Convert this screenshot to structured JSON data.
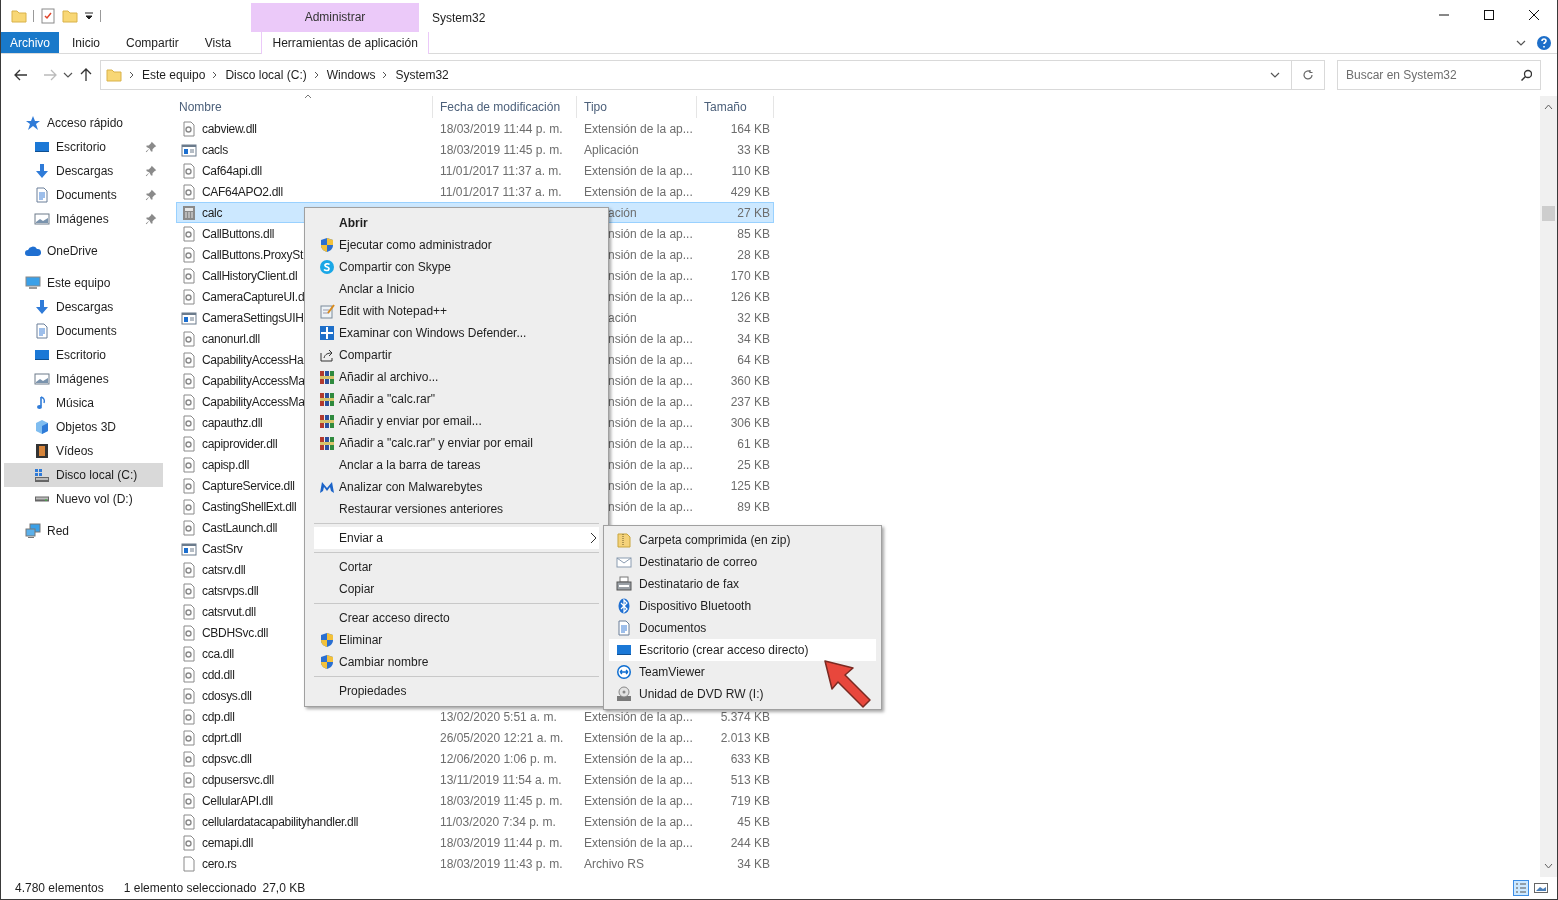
{
  "window": {
    "title": "System32",
    "contextual_group": "Administrar"
  },
  "ribbon": {
    "tabs": [
      {
        "label": "Archivo",
        "kind": "file"
      },
      {
        "label": "Inicio",
        "kind": "normal"
      },
      {
        "label": "Compartir",
        "kind": "normal"
      },
      {
        "label": "Vista",
        "kind": "normal"
      },
      {
        "label": "Herramientas de aplicación",
        "kind": "contextual"
      }
    ]
  },
  "address": {
    "crumbs": [
      "Este equipo",
      "Disco local (C:)",
      "Windows",
      "System32"
    ]
  },
  "search": {
    "placeholder": "Buscar en System32"
  },
  "sidebar": {
    "groups": [
      {
        "label": "Acceso rápido",
        "selected": false,
        "children": [
          {
            "label": "Escritorio",
            "pinned": true,
            "selected": false
          },
          {
            "label": "Descargas",
            "pinned": true,
            "selected": false
          },
          {
            "label": "Documents",
            "pinned": true,
            "selected": false
          },
          {
            "label": "Imágenes",
            "pinned": true,
            "selected": false
          }
        ]
      },
      {
        "label": "OneDrive",
        "selected": false
      },
      {
        "label": "Este equipo",
        "selected": false,
        "children": [
          {
            "label": "Descargas",
            "pinned": false,
            "selected": false
          },
          {
            "label": "Documents",
            "pinned": false,
            "selected": false
          },
          {
            "label": "Escritorio",
            "pinned": false,
            "selected": false
          },
          {
            "label": "Imágenes",
            "pinned": false,
            "selected": false
          },
          {
            "label": "Música",
            "pinned": false,
            "selected": false
          },
          {
            "label": "Objetos 3D",
            "pinned": false,
            "selected": false
          },
          {
            "label": "Vídeos",
            "pinned": false,
            "selected": false
          },
          {
            "label": "Disco local (C:)",
            "pinned": false,
            "selected": true
          },
          {
            "label": "Nuevo vol (D:)",
            "pinned": false,
            "selected": false
          }
        ]
      },
      {
        "label": "Red",
        "selected": false
      }
    ]
  },
  "file_list": {
    "columns": [
      {
        "label": "Nombre",
        "sorted": true
      },
      {
        "label": "Fecha de modificación",
        "sorted": false
      },
      {
        "label": "Tipo",
        "sorted": false
      },
      {
        "label": "Tamaño",
        "sorted": false
      }
    ],
    "rows": [
      {
        "name": "cabview.dll",
        "kind": "dll",
        "date": "18/03/2019 11:44 p. m.",
        "type": "Extensión de la ap...",
        "size": "164 KB",
        "selected": false
      },
      {
        "name": "cacls",
        "kind": "app",
        "date": "18/03/2019 11:45 p. m.",
        "type": "Aplicación",
        "size": "33 KB",
        "selected": false
      },
      {
        "name": "Caf64api.dll",
        "kind": "dll",
        "date": "11/01/2017 11:37 a. m.",
        "type": "Extensión de la ap...",
        "size": "110 KB",
        "selected": false
      },
      {
        "name": "CAF64APO2.dll",
        "kind": "dll",
        "date": "11/01/2017 11:37 a. m.",
        "type": "Extensión de la ap...",
        "size": "429 KB",
        "selected": false
      },
      {
        "name": "calc",
        "kind": "calc",
        "type": "ación",
        "size": "27 KB",
        "selected": true
      },
      {
        "name": "CallButtons.dll",
        "kind": "dll",
        "type": "nsión de la ap...",
        "size": "85 KB",
        "selected": false
      },
      {
        "name": "CallButtons.ProxySt",
        "kind": "dll",
        "type": "nsión de la ap...",
        "size": "28 KB",
        "selected": false
      },
      {
        "name": "CallHistoryClient.dl",
        "kind": "dll",
        "type": "nsión de la ap...",
        "size": "170 KB",
        "selected": false
      },
      {
        "name": "CameraCaptureUI.d",
        "kind": "dll",
        "type": "nsión de la ap...",
        "size": "126 KB",
        "selected": false
      },
      {
        "name": "CameraSettingsUIH",
        "kind": "app",
        "type": "ación",
        "size": "32 KB",
        "selected": false
      },
      {
        "name": "canonurl.dll",
        "kind": "dll",
        "type": "nsión de la ap...",
        "size": "34 KB",
        "selected": false
      },
      {
        "name": "CapabilityAccessHa",
        "kind": "dll",
        "type": "nsión de la ap...",
        "size": "64 KB",
        "selected": false
      },
      {
        "name": "CapabilityAccessMa",
        "kind": "dll",
        "type": "nsión de la ap...",
        "size": "360 KB",
        "selected": false
      },
      {
        "name": "CapabilityAccessMa",
        "kind": "dll",
        "type": "nsión de la ap...",
        "size": "237 KB",
        "selected": false
      },
      {
        "name": "capauthz.dll",
        "kind": "dll",
        "type": "nsión de la ap...",
        "size": "306 KB",
        "selected": false
      },
      {
        "name": "capiprovider.dll",
        "kind": "dll",
        "type": "nsión de la ap...",
        "size": "61 KB",
        "selected": false
      },
      {
        "name": "capisp.dll",
        "kind": "dll",
        "type": "nsión de la ap...",
        "size": "25 KB",
        "selected": false
      },
      {
        "name": "CaptureService.dll",
        "kind": "dll",
        "type": "nsión de la ap...",
        "size": "125 KB",
        "selected": false
      },
      {
        "name": "CastingShellExt.dll",
        "kind": "dll",
        "type": "nsión de la ap...",
        "size": "89 KB",
        "selected": false
      },
      {
        "name": "CastLaunch.dll",
        "kind": "dll",
        "selected": false
      },
      {
        "name": "CastSrv",
        "kind": "app",
        "selected": false
      },
      {
        "name": "catsrv.dll",
        "kind": "dll",
        "selected": false
      },
      {
        "name": "catsrvps.dll",
        "kind": "dll",
        "selected": false
      },
      {
        "name": "catsrvut.dll",
        "kind": "dll",
        "selected": false
      },
      {
        "name": "CBDHSvc.dll",
        "kind": "dll",
        "selected": false
      },
      {
        "name": "cca.dll",
        "kind": "dll",
        "selected": false
      },
      {
        "name": "cdd.dll",
        "kind": "dll",
        "selected": false
      },
      {
        "name": "cdosys.dll",
        "kind": "dll",
        "selected": false
      },
      {
        "name": "cdp.dll",
        "kind": "dll",
        "date": "13/02/2020 5:51 a. m.",
        "type": "Extensión de la ap...",
        "size": "5.374 KB",
        "selected": false
      },
      {
        "name": "cdprt.dll",
        "kind": "dll",
        "date": "26/05/2020 12:21 a. m.",
        "type": "Extensión de la ap...",
        "size": "2.013 KB",
        "selected": false
      },
      {
        "name": "cdpsvc.dll",
        "kind": "dll",
        "date": "12/06/2020 1:06 p. m.",
        "type": "Extensión de la ap...",
        "size": "633 KB",
        "selected": false
      },
      {
        "name": "cdpusersvc.dll",
        "kind": "dll",
        "date": "13/11/2019 11:54 a. m.",
        "type": "Extensión de la ap...",
        "size": "513 KB",
        "selected": false
      },
      {
        "name": "CellularAPI.dll",
        "kind": "dll",
        "date": "18/03/2019 11:45 p. m.",
        "type": "Extensión de la ap...",
        "size": "719 KB",
        "selected": false
      },
      {
        "name": "cellulardatacapabilityhandler.dll",
        "kind": "dll",
        "date": "11/03/2020 7:34 p. m.",
        "type": "Extensión de la ap...",
        "size": "45 KB",
        "selected": false
      },
      {
        "name": "cemapi.dll",
        "kind": "dll",
        "date": "18/03/2019 11:44 p. m.",
        "type": "Extensión de la ap...",
        "size": "244 KB",
        "selected": false
      },
      {
        "name": "cero.rs",
        "kind": "file",
        "date": "18/03/2019 11:43 p. m.",
        "type": "Archivo RS",
        "size": "34 KB",
        "selected": false
      }
    ]
  },
  "context_menu": {
    "items": [
      {
        "kind": "item",
        "label": "Abrir",
        "default": true,
        "selected": false
      },
      {
        "kind": "item",
        "label": "Ejecutar como administrador",
        "default": false,
        "selected": false
      },
      {
        "kind": "item",
        "label": "Compartir con Skype",
        "default": false,
        "selected": false
      },
      {
        "kind": "item",
        "label": "Anclar a Inicio",
        "default": false,
        "selected": false
      },
      {
        "kind": "item",
        "label": "Edit with Notepad++",
        "default": false,
        "selected": false
      },
      {
        "kind": "item",
        "label": "Examinar con Windows Defender...",
        "default": false,
        "selected": false
      },
      {
        "kind": "item",
        "label": "Compartir",
        "default": false,
        "selected": false
      },
      {
        "kind": "item",
        "label": "Añadir al archivo...",
        "default": false,
        "selected": false
      },
      {
        "kind": "item",
        "label": "Añadir a \"calc.rar\"",
        "default": false,
        "selected": false
      },
      {
        "kind": "item",
        "label": "Añadir y enviar por email...",
        "default": false,
        "selected": false
      },
      {
        "kind": "item",
        "label": "Añadir a \"calc.rar\" y enviar por email",
        "default": false,
        "selected": false
      },
      {
        "kind": "item",
        "label": "Anclar a la barra de tareas",
        "default": false,
        "selected": false
      },
      {
        "kind": "item",
        "label": "Analizar con Malwarebytes",
        "default": false,
        "selected": false
      },
      {
        "kind": "item",
        "label": "Restaurar versiones anteriores",
        "default": false,
        "selected": false
      },
      {
        "kind": "separator"
      },
      {
        "kind": "submenu",
        "label": "Enviar a",
        "default": false,
        "selected": true
      },
      {
        "kind": "separator"
      },
      {
        "kind": "item",
        "label": "Cortar",
        "default": false,
        "selected": false
      },
      {
        "kind": "item",
        "label": "Copiar",
        "default": false,
        "selected": false
      },
      {
        "kind": "separator"
      },
      {
        "kind": "item",
        "label": "Crear acceso directo",
        "default": false,
        "selected": false
      },
      {
        "kind": "item",
        "label": "Eliminar",
        "default": false,
        "selected": false
      },
      {
        "kind": "item",
        "label": "Cambiar nombre",
        "default": false,
        "selected": false
      },
      {
        "kind": "separator"
      },
      {
        "kind": "item",
        "label": "Propiedades",
        "default": false,
        "selected": false
      }
    ]
  },
  "send_to_menu": {
    "items": [
      {
        "label": "Carpeta comprimida (en zip)",
        "selected": false
      },
      {
        "label": "Destinatario de correo",
        "selected": false
      },
      {
        "label": "Destinatario de fax",
        "selected": false
      },
      {
        "label": "Dispositivo Bluetooth",
        "selected": false
      },
      {
        "label": "Documentos",
        "selected": false
      },
      {
        "label": "Escritorio (crear acceso directo)",
        "selected": true
      },
      {
        "label": "TeamViewer",
        "selected": false
      },
      {
        "label": "Unidad de DVD RW (I:)",
        "selected": false
      }
    ]
  },
  "status_bar": {
    "item_count": "4.780 elementos",
    "selection": "1 elemento seleccionado",
    "selection_size": "27,0 KB"
  }
}
